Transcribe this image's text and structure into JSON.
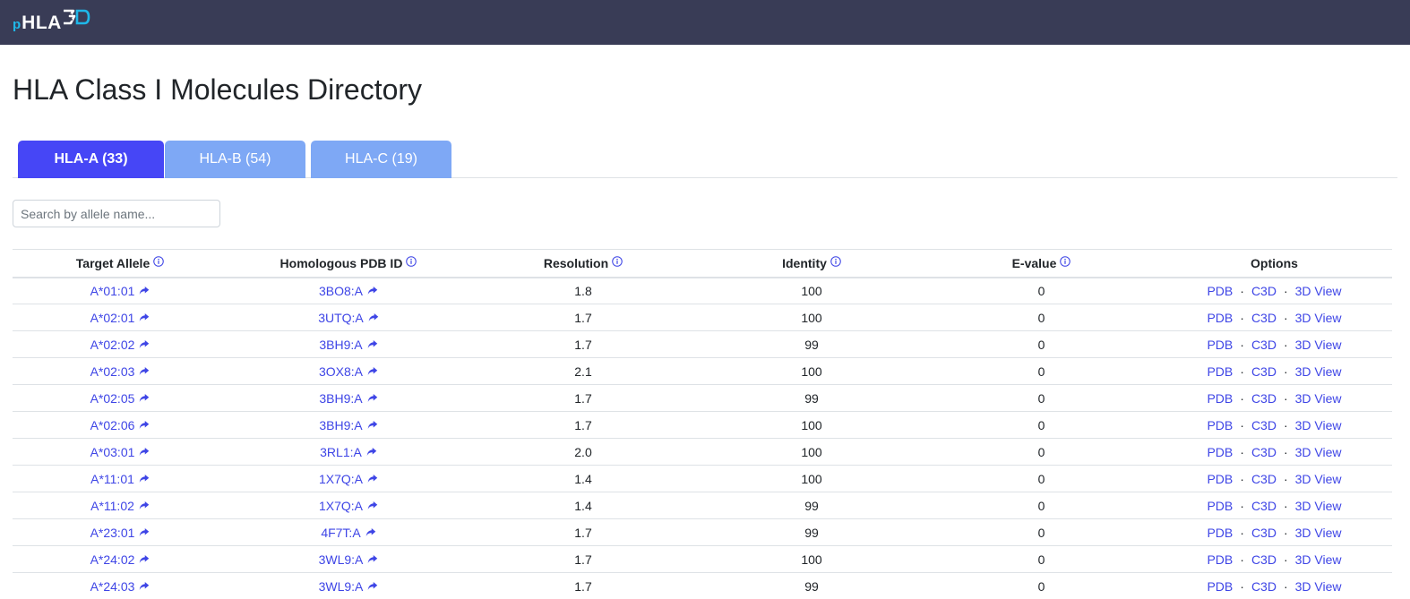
{
  "logo": {
    "prefix": "p",
    "text": "HLA"
  },
  "title": "HLA Class I Molecules Directory",
  "tabs": [
    {
      "label": "HLA-A (33)",
      "active": true
    },
    {
      "label": "HLA-B (54)",
      "active": false
    },
    {
      "label": "HLA-C (19)",
      "active": false
    }
  ],
  "search": {
    "placeholder": "Search by allele name...",
    "value": ""
  },
  "table": {
    "headers": [
      "Target Allele",
      "Homologous PDB ID",
      "Resolution",
      "Identity",
      "E-value",
      "Options"
    ],
    "option_labels": [
      "PDB",
      "C3D",
      "3D View"
    ],
    "option_separator": "·",
    "rows": [
      [
        "A*01:01",
        "3BO8:A",
        "1.8",
        "100",
        "0"
      ],
      [
        "A*02:01",
        "3UTQ:A",
        "1.7",
        "100",
        "0"
      ],
      [
        "A*02:02",
        "3BH9:A",
        "1.7",
        "99",
        "0"
      ],
      [
        "A*02:03",
        "3OX8:A",
        "2.1",
        "100",
        "0"
      ],
      [
        "A*02:05",
        "3BH9:A",
        "1.7",
        "99",
        "0"
      ],
      [
        "A*02:06",
        "3BH9:A",
        "1.7",
        "100",
        "0"
      ],
      [
        "A*03:01",
        "3RL1:A",
        "2.0",
        "100",
        "0"
      ],
      [
        "A*11:01",
        "1X7Q:A",
        "1.4",
        "100",
        "0"
      ],
      [
        "A*11:02",
        "1X7Q:A",
        "1.4",
        "99",
        "0"
      ],
      [
        "A*23:01",
        "4F7T:A",
        "1.7",
        "99",
        "0"
      ],
      [
        "A*24:02",
        "3WL9:A",
        "1.7",
        "100",
        "0"
      ],
      [
        "A*24:03",
        "3WL9:A",
        "1.7",
        "99",
        "0"
      ]
    ]
  },
  "colors": {
    "navbar": "#393c56",
    "logo_accent": "#1fb7e8",
    "tab_active": "#4646f6",
    "tab_inactive": "#7ea8f5",
    "link": "#3e45e6"
  },
  "icons": {
    "header_info": "info-circle-icon",
    "link_share": "share-arrow-icon",
    "logo_3d": "logo-3d-mark-icon"
  }
}
